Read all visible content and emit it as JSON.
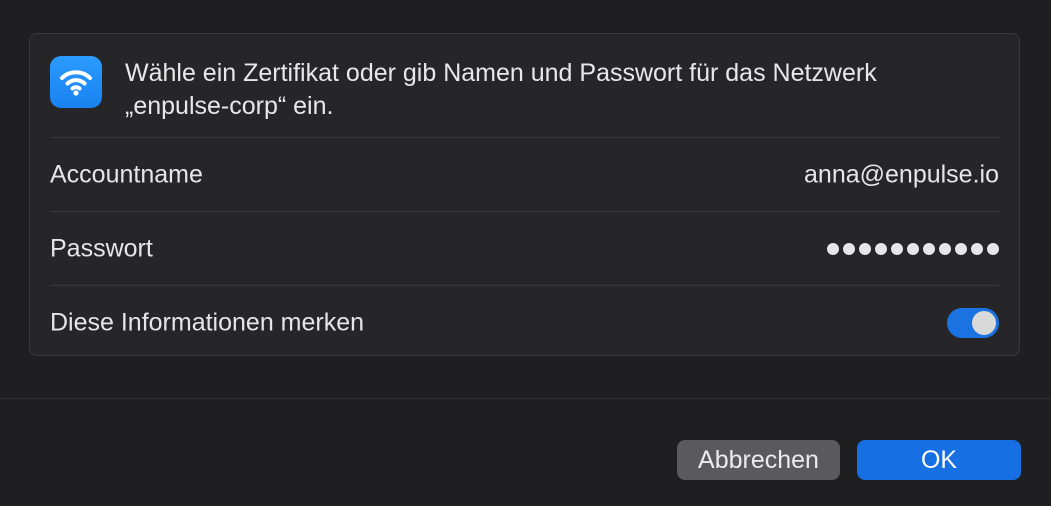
{
  "dialog": {
    "prompt_line1": "Wähle ein Zertifikat oder gib Namen und Passwort für das Netzwerk",
    "prompt_line2": "„enpulse-corp“ ein.",
    "icon": "wifi-icon"
  },
  "fields": {
    "account_label": "Accountname",
    "account_value": "anna@enpulse.io",
    "password_label": "Passwort",
    "password_masked_length": 11,
    "remember_label": "Diese Informationen merken",
    "remember_on": true
  },
  "buttons": {
    "cancel_label": "Abbrechen",
    "ok_label": "OK"
  },
  "colors": {
    "accent": "#1670e4",
    "wifi_tile": "#1a82f0",
    "background": "#1f1f21",
    "panel": "#262628"
  }
}
